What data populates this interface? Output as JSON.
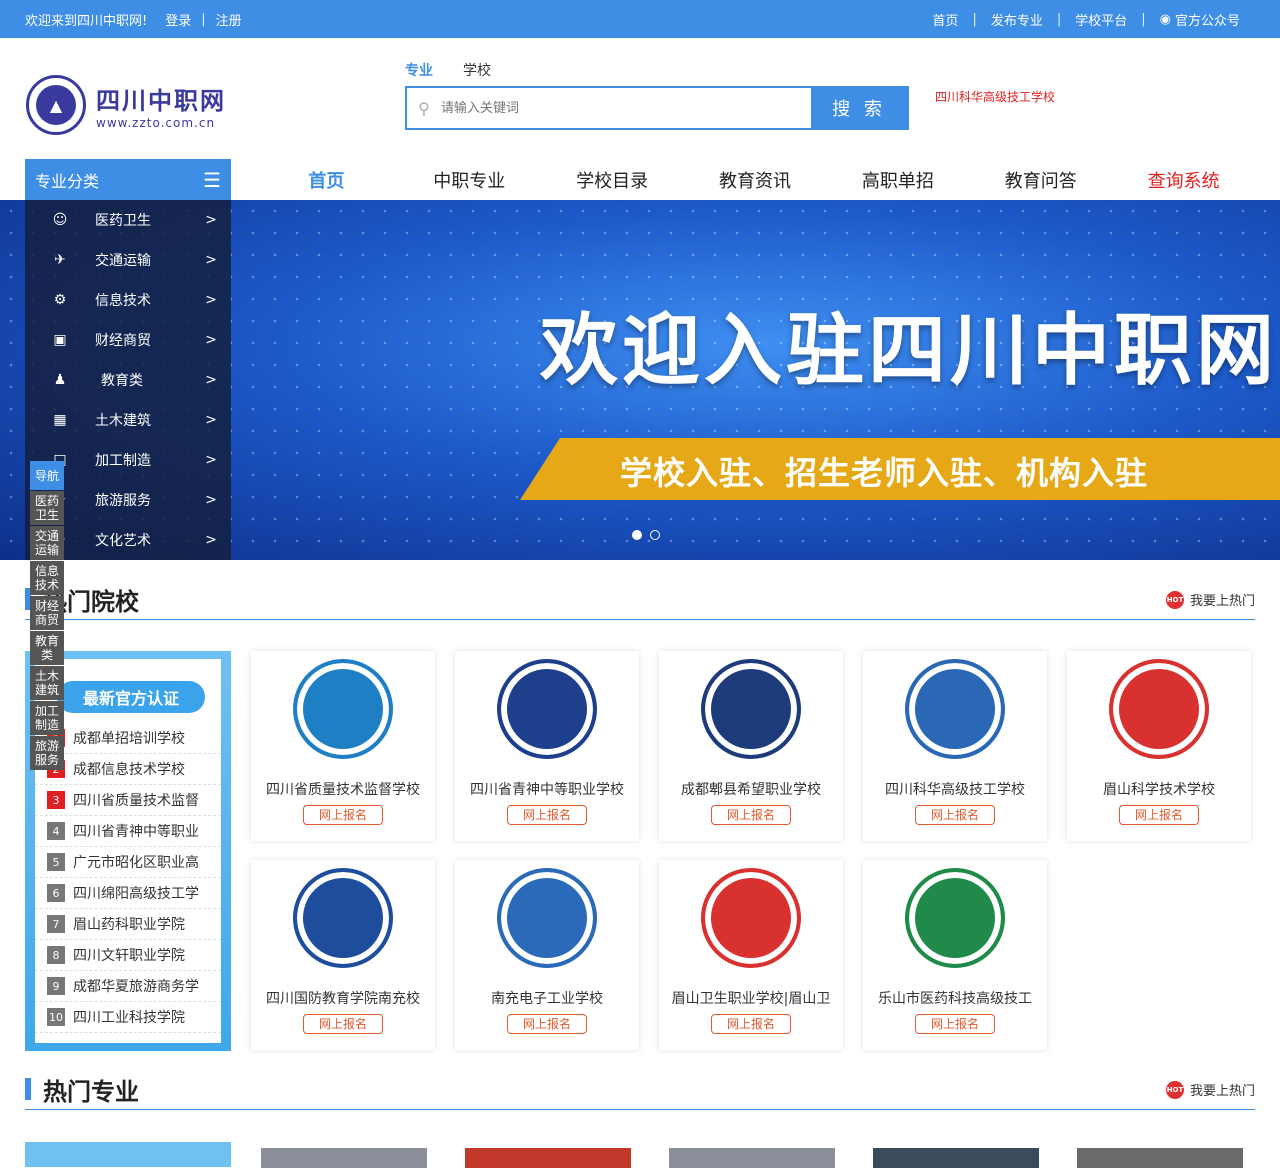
{
  "topbar": {
    "welcome": "欢迎来到四川中职网!",
    "login": "登录",
    "sep": "|",
    "register": "注册",
    "links": [
      "首页",
      "发布专业",
      "学校平台",
      "官方公众号"
    ]
  },
  "logo": {
    "cn": "四川中职网",
    "en": "www.zzto.com.cn"
  },
  "search": {
    "tabs": [
      "专业",
      "学校"
    ],
    "placeholder": "请输入关键词",
    "button": "搜 索",
    "hot_link": "四川科华高级技工学校"
  },
  "category_head": "专业分类",
  "nav": [
    "首页",
    "中职专业",
    "学校目录",
    "教育资讯",
    "高职单招",
    "教育问答",
    "查询系统"
  ],
  "categories": [
    "医药卫生",
    "交通运输",
    "信息技术",
    "财经商贸",
    "教育类",
    "土木建筑",
    "加工制造",
    "旅游服务",
    "文化艺术"
  ],
  "banner": {
    "headline": "欢迎入驻四川中职网",
    "strip": "学校入驻、招生老师入驻、机构入驻"
  },
  "float_nav": {
    "head": "导航",
    "items": [
      "医药卫生",
      "交通运输",
      "信息技术",
      "财经商贸",
      "教育类",
      "土木建筑",
      "加工制造",
      "旅游服务"
    ]
  },
  "hot_schools": {
    "title": "热门院校",
    "more": "我要上热门",
    "badge": "最新官方认证",
    "ranking": [
      {
        "n": "1",
        "name": "成都单招培训学校"
      },
      {
        "n": "2",
        "name": "成都信息技术学校"
      },
      {
        "n": "3",
        "name": "四川省质量技术监督"
      },
      {
        "n": "4",
        "name": "四川省青神中等职业"
      },
      {
        "n": "5",
        "name": "广元市昭化区职业高"
      },
      {
        "n": "6",
        "name": "四川绵阳高级技工学"
      },
      {
        "n": "7",
        "name": "眉山药科职业学院"
      },
      {
        "n": "8",
        "name": "四川文轩职业学院"
      },
      {
        "n": "9",
        "name": "成都华夏旅游商务学"
      },
      {
        "n": "10",
        "name": "四川工业科技学院"
      }
    ],
    "cards": [
      {
        "name": "四川省质量技术监督学校",
        "apply": "网上报名",
        "color": "#1f7fc4"
      },
      {
        "name": "四川省青神中等职业学校",
        "apply": "网上报名",
        "color": "#1e3f8c"
      },
      {
        "name": "成都郫县希望职业学校",
        "apply": "网上报名",
        "color": "#1d3a7a"
      },
      {
        "name": "四川科华高级技工学校",
        "apply": "网上报名",
        "color": "#2a68b6"
      },
      {
        "name": "眉山科学技术学校",
        "apply": "网上报名",
        "color": "#d93030"
      },
      {
        "name": "四川国防教育学院南充校",
        "apply": "网上报名",
        "color": "#1d4d9c"
      },
      {
        "name": "南充电子工业学校",
        "apply": "网上报名",
        "color": "#2a6ab8"
      },
      {
        "name": "眉山卫生职业学校|眉山卫",
        "apply": "网上报名",
        "color": "#d93030"
      },
      {
        "name": "乐山市医药科技高级技工",
        "apply": "网上报名",
        "color": "#1f8a4a"
      }
    ]
  },
  "hot_majors": {
    "title": "热门专业",
    "more": "我要上热门"
  },
  "icons": {
    "search": "search-icon",
    "menu": "list-icon",
    "wechat": "wechat-icon",
    "hot": "hot-icon"
  }
}
